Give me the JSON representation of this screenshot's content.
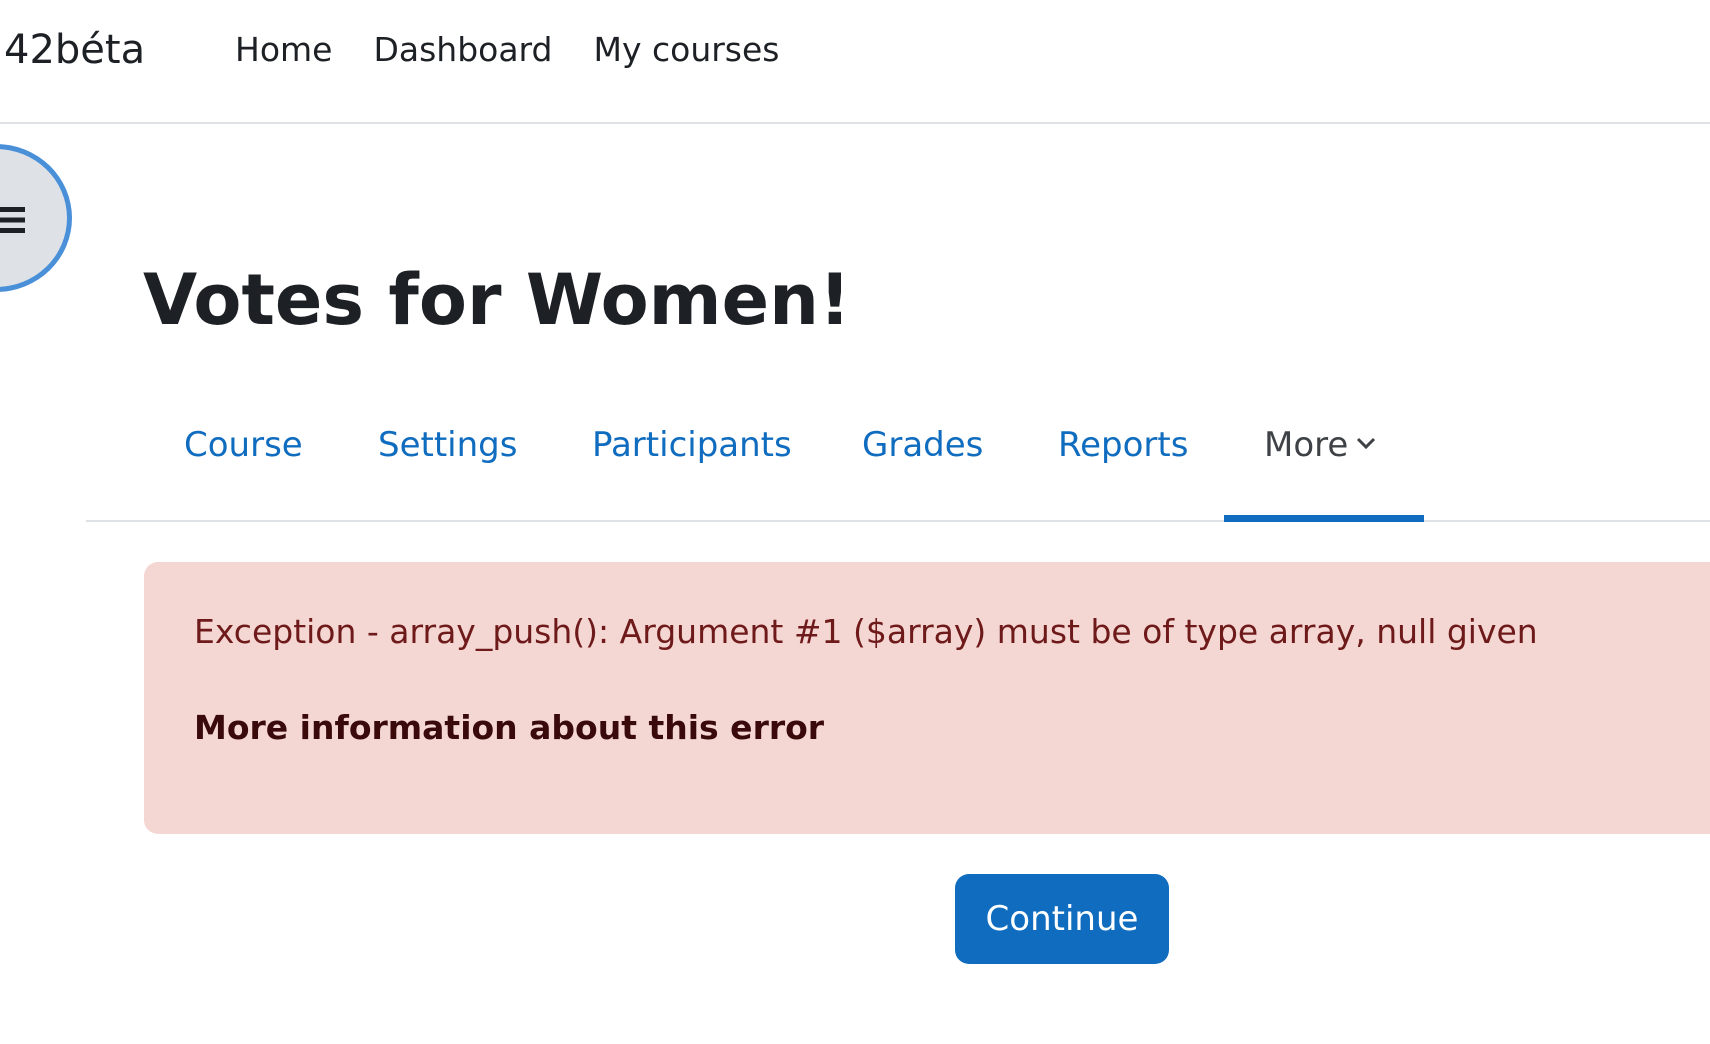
{
  "header": {
    "brand": "42béta",
    "nav": [
      {
        "label": "Home"
      },
      {
        "label": "Dashboard"
      },
      {
        "label": "My courses"
      }
    ]
  },
  "drawer": {
    "icon": "list-icon"
  },
  "course": {
    "title": "Votes for Women!"
  },
  "secondary_nav": {
    "tabs": [
      {
        "label": "Course"
      },
      {
        "label": "Settings"
      },
      {
        "label": "Participants"
      },
      {
        "label": "Grades"
      },
      {
        "label": "Reports"
      },
      {
        "label": "More",
        "icon": "chevron-down-icon",
        "active": true
      }
    ]
  },
  "error": {
    "message": "Exception - array_push(): Argument #1 ($array) must be of type array, null given",
    "more_info_link": "More information about this error"
  },
  "actions": {
    "continue_label": "Continue"
  },
  "colors": {
    "link": "#0f6cbf",
    "alert_background": "#f4d6d2",
    "alert_text": "#6e1a1a",
    "drawer_ring": "#4a90d9"
  }
}
